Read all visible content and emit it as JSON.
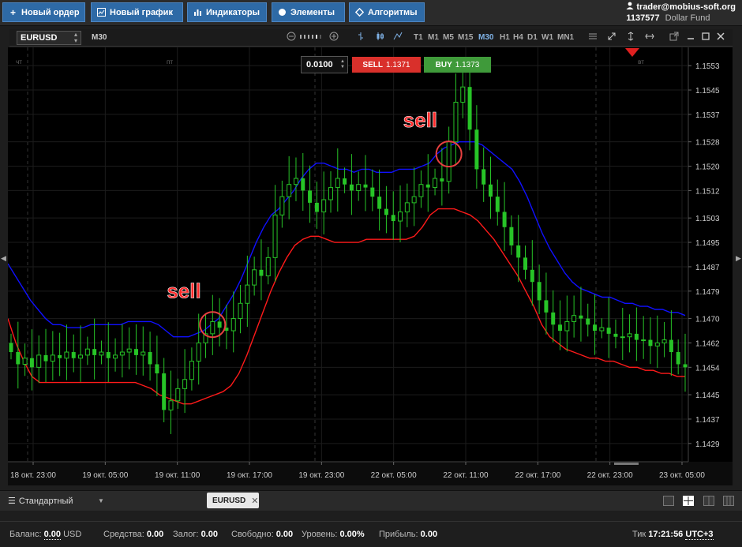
{
  "toolbar": {
    "new_order": "Новый ордер",
    "new_chart": "Новый график",
    "indicators": "Индикаторы",
    "elements": "Элементы",
    "algorithms": "Алгоритмы"
  },
  "account": {
    "email": "trader@mobius-soft.org",
    "number": "1137577",
    "fund": "Dollar Fund"
  },
  "chart_header": {
    "symbol": "EURUSD",
    "timeframe": "M30",
    "timeframes": [
      "T1",
      "M1",
      "M5",
      "M15",
      "M30",
      "H1",
      "H4",
      "D1",
      "W1",
      "MN1"
    ],
    "active_timeframe": "M30"
  },
  "trade": {
    "lot": "0.0100",
    "sell_label": "SELL",
    "sell_price": "1.1371",
    "buy_label": "BUY",
    "buy_price": "1.1373"
  },
  "chart_data": {
    "type": "candlestick",
    "symbol": "EURUSD",
    "ylim": [
      1.1423,
      1.1559
    ],
    "y_ticks": [
      "1.1553",
      "1.1545",
      "1.1537",
      "1.1528",
      "1.1520",
      "1.1512",
      "1.1503",
      "1.1495",
      "1.1487",
      "1.1479",
      "1.1470",
      "1.1462",
      "1.1454",
      "1.1445",
      "1.1437",
      "1.1429"
    ],
    "x_ticks": [
      "18 окт. 23:00",
      "19 окт. 05:00",
      "19 окт. 11:00",
      "19 окт. 17:00",
      "19 окт. 23:00",
      "22 окт. 05:00",
      "22 окт. 11:00",
      "22 окт. 17:00",
      "22 окт. 23:00",
      "23 окт. 05:00"
    ],
    "day_labels": [
      "чт",
      "пт",
      "вт"
    ],
    "annotations": [
      {
        "text": "sell",
        "x_index": 29,
        "y": 1.1468
      },
      {
        "text": "sell",
        "x_index": 63,
        "y": 1.1524
      }
    ],
    "colors": {
      "background": "#000000",
      "candle": "#27c427",
      "upper_band": "#1010ff",
      "lower_band": "#ff1a1a",
      "annotation_text": "#ff2a2a",
      "annotation_circle": "#e84040"
    },
    "close": [
      1.1459,
      1.1455,
      1.1457,
      1.1454,
      1.1458,
      1.1456,
      1.1458,
      1.1457,
      1.1459,
      1.1457,
      1.1458,
      1.146,
      1.1458,
      1.1459,
      1.1457,
      1.1458,
      1.1459,
      1.146,
      1.1458,
      1.1459,
      1.1455,
      1.1452,
      1.144,
      1.1443,
      1.1447,
      1.145,
      1.1456,
      1.1462,
      1.1465,
      1.1469,
      1.1467,
      1.1466,
      1.147,
      1.1475,
      1.1481,
      1.1486,
      1.1484,
      1.149,
      1.1504,
      1.151,
      1.1514,
      1.1516,
      1.1512,
      1.1508,
      1.1505,
      1.1509,
      1.1513,
      1.1516,
      1.1514,
      1.1512,
      1.1514,
      1.1513,
      1.151,
      1.1506,
      1.1504,
      1.1502,
      1.1505,
      1.1508,
      1.151,
      1.1514,
      1.1513,
      1.1516,
      1.1515,
      1.1528,
      1.1541,
      1.1546,
      1.1532,
      1.1519,
      1.1514,
      1.151,
      1.1505,
      1.15,
      1.1494,
      1.149,
      1.1486,
      1.1482,
      1.1476,
      1.1472,
      1.1468,
      1.1466,
      1.1469,
      1.1471,
      1.147,
      1.1468,
      1.1466,
      1.1467,
      1.1465,
      1.1464,
      1.1464,
      1.1465,
      1.1463,
      1.1463,
      1.1461,
      1.1462,
      1.1463,
      1.1459,
      1.1455,
      1.1454
    ],
    "upper_band": [
      1.1488,
      1.1484,
      1.148,
      1.1476,
      1.1473,
      1.147,
      1.1468,
      1.1468,
      1.1467,
      1.1467,
      1.1467,
      1.1468,
      1.1468,
      1.1468,
      1.1468,
      1.1468,
      1.1469,
      1.1469,
      1.1469,
      1.1469,
      1.1468,
      1.1466,
      1.1464,
      1.1464,
      1.1464,
      1.1465,
      1.1466,
      1.1468,
      1.147,
      1.1474,
      1.1478,
      1.1483,
      1.1489,
      1.1495,
      1.15,
      1.1504,
      1.1506,
      1.1509,
      1.1512,
      1.1516,
      1.1519,
      1.1521,
      1.1521,
      1.152,
      1.1519,
      1.1519,
      1.1518,
      1.1519,
      1.1519,
      1.1518,
      1.1518,
      1.1518,
      1.1519,
      1.1519,
      1.1519,
      1.152,
      1.1521,
      1.1524,
      1.1526,
      1.1527,
      1.1528,
      1.1528,
      1.1528,
      1.1527,
      1.1525,
      1.1523,
      1.1521,
      1.1519,
      1.1515,
      1.151,
      1.1504,
      1.1498,
      1.1493,
      1.1489,
      1.1485,
      1.1482,
      1.148,
      1.1479,
      1.1478,
      1.1477,
      1.1477,
      1.1476,
      1.1475,
      1.1475,
      1.1474,
      1.1474,
      1.1473,
      1.1473,
      1.1472,
      1.1472,
      1.1471
    ],
    "lower_band": [
      1.147,
      1.1462,
      1.1456,
      1.1451,
      1.1449,
      1.1449,
      1.1449,
      1.1449,
      1.1449,
      1.1449,
      1.1449,
      1.1449,
      1.1449,
      1.1449,
      1.1449,
      1.1449,
      1.1449,
      1.1448,
      1.1447,
      1.1445,
      1.1444,
      1.1443,
      1.1442,
      1.1442,
      1.1443,
      1.1444,
      1.1445,
      1.1446,
      1.1448,
      1.1452,
      1.1458,
      1.1465,
      1.1472,
      1.1479,
      1.1485,
      1.149,
      1.1494,
      1.1496,
      1.1497,
      1.1497,
      1.1496,
      1.1495,
      1.1495,
      1.1495,
      1.1495,
      1.1496,
      1.1496,
      1.1496,
      1.1496,
      1.1496,
      1.1496,
      1.1497,
      1.15,
      1.1504,
      1.1506,
      1.1506,
      1.1506,
      1.1505,
      1.1504,
      1.1502,
      1.1499,
      1.1496,
      1.1492,
      1.1488,
      1.1484,
      1.1479,
      1.1474,
      1.1468,
      1.1464,
      1.1462,
      1.146,
      1.1459,
      1.1458,
      1.1457,
      1.1457,
      1.1456,
      1.1456,
      1.1455,
      1.1454,
      1.1454,
      1.1453,
      1.1453,
      1.1452,
      1.1452,
      1.1451,
      1.1451
    ]
  },
  "tabs": {
    "template": "Стандартный",
    "chart_tab": "EURUSD"
  },
  "status": {
    "balance_label": "Баланс:",
    "balance_value": "0.00",
    "currency": "USD",
    "funds_label": "Средства:",
    "funds_value": "0.00",
    "margin_label": "Залог:",
    "margin_value": "0.00",
    "free_label": "Свободно:",
    "free_value": "0.00",
    "level_label": "Уровень:",
    "level_value": "0.00%",
    "profit_label": "Прибыль:",
    "profit_value": "0.00",
    "tick_label": "Тик",
    "time": "17:21:56",
    "tz": "UTC+3"
  }
}
